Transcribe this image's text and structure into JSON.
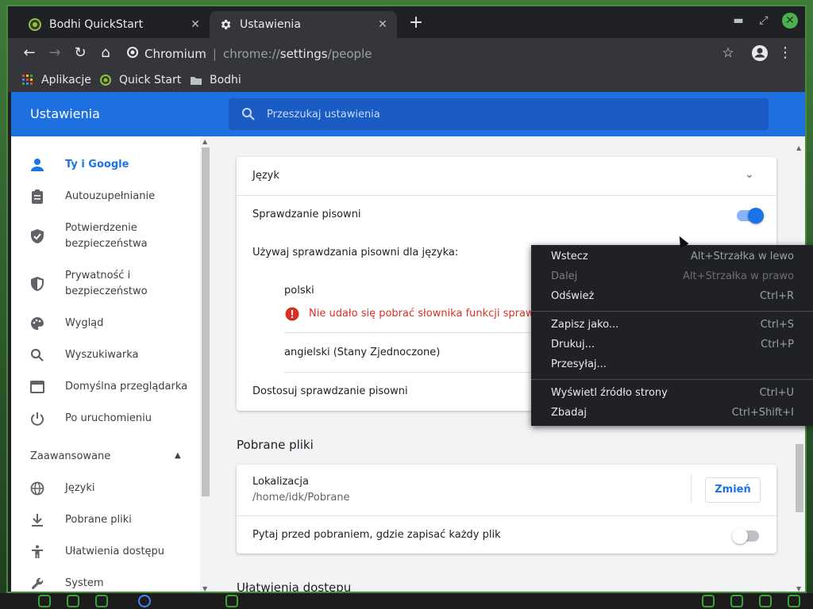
{
  "tabs": [
    {
      "title": "Bodhi QuickStart",
      "icon": "bodhi-leaf-icon"
    },
    {
      "title": "Ustawienia",
      "icon": "gear-icon"
    }
  ],
  "omnibox": {
    "chip": "Chromium",
    "url_prefix": "chrome://",
    "url_path": "settings",
    "url_suffix": "/people"
  },
  "bookmarks": [
    {
      "label": "Aplikacje",
      "icon": "apps-grid-icon"
    },
    {
      "label": "Quick Start",
      "icon": "bodhi-leaf-icon"
    },
    {
      "label": "Bodhi",
      "icon": "folder-icon"
    }
  ],
  "header": {
    "title": "Ustawienia",
    "search_placeholder": "Przeszukaj ustawienia"
  },
  "sidebar": {
    "items": [
      {
        "label": "Ty i Google",
        "icon": "person-icon",
        "active": true
      },
      {
        "label": "Autouzupełnianie",
        "icon": "clipboard-icon"
      },
      {
        "label": "Potwierdzenie",
        "label2": "bezpieczeństwa",
        "icon": "shield-check-icon"
      },
      {
        "label": "Prywatność i",
        "label2": "bezpieczeństwo",
        "icon": "shield-half-icon"
      },
      {
        "label": "Wygląd",
        "icon": "palette-icon"
      },
      {
        "label": "Wyszukiwarka",
        "icon": "search-icon"
      },
      {
        "label": "Domyślna przeglądarka",
        "icon": "browser-icon"
      },
      {
        "label": "Po uruchomieniu",
        "icon": "power-icon"
      }
    ],
    "advanced_label": "Zaawansowane",
    "advanced_items": [
      {
        "label": "Języki",
        "icon": "globe-icon"
      },
      {
        "label": "Pobrane pliki",
        "icon": "download-icon"
      },
      {
        "label": "Ułatwienia dostępu",
        "icon": "accessibility-icon"
      },
      {
        "label": "System",
        "icon": "wrench-icon"
      }
    ]
  },
  "language_card": {
    "title": "Język",
    "spellcheck_label": "Sprawdzanie pisowni",
    "spellcheck_on": true,
    "use_for_label": "Używaj sprawdzania pisowni dla języka:",
    "lang1": "polski",
    "lang1_error": "Nie udało się pobrać słownika funkcji sprawdzania",
    "lang2": "angielski (Stany Zjednoczone)",
    "customize_label": "Dostosuj sprawdzanie pisowni"
  },
  "downloads": {
    "section_title": "Pobrane pliki",
    "location_label": "Lokalizacja",
    "location_path": "/home/idk/Pobrane",
    "change_button": "Zmień",
    "ask_label": "Pytaj przed pobraniem, gdzie zapisać każdy plik",
    "ask_on": false
  },
  "accessibility_section": "Ułatwienia dostępu",
  "context_menu": {
    "items": [
      {
        "label": "Wstecz",
        "shortcut": "Alt+Strzałka w lewo",
        "disabled": false
      },
      {
        "label": "Dalej",
        "shortcut": "Alt+Strzałka w prawo",
        "disabled": true
      },
      {
        "label": "Odśwież",
        "shortcut": "Ctrl+R",
        "disabled": false
      },
      {
        "label": "Zapisz jako...",
        "shortcut": "Ctrl+S",
        "disabled": false
      },
      {
        "label": "Drukuj...",
        "shortcut": "Ctrl+P",
        "disabled": false
      },
      {
        "label": "Przesyłaj...",
        "shortcut": "",
        "disabled": false
      },
      {
        "label": "Wyświetl źródło strony",
        "shortcut": "Ctrl+U",
        "disabled": false
      },
      {
        "label": "Zbadaj",
        "shortcut": "Ctrl+Shift+I",
        "disabled": false
      }
    ]
  },
  "colors": {
    "accent": "#1a73e8",
    "header": "#1e6fe0",
    "error": "#d93025",
    "menu_bg": "#202124"
  }
}
